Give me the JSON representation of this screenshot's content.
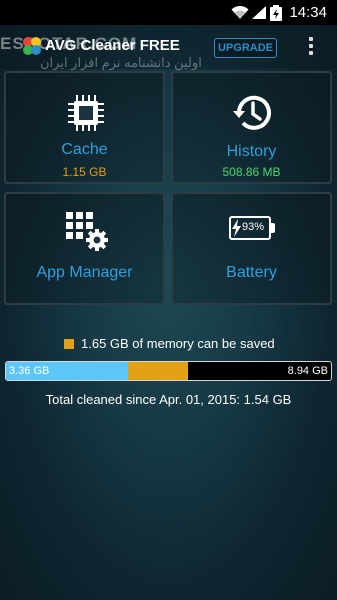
{
  "status_bar": {
    "time": "14:34"
  },
  "app_bar": {
    "title": "AVG Cleaner FREE",
    "upgrade_label": "UPGRADE",
    "watermark": "ESCOTAR.COM",
    "watermark_fa": "اولین دانشنامه نرم افزار ایران"
  },
  "tiles": [
    {
      "label": "Cache",
      "sub": "1.15 GB",
      "sub_color": "#e3a216",
      "icon": "chip-icon"
    },
    {
      "label": "History",
      "sub": "508.86 MB",
      "sub_color": "#4bd46b",
      "icon": "history-clock-icon"
    },
    {
      "label": "App Manager",
      "sub": "",
      "icon": "app-grid-gear-icon"
    },
    {
      "label": "Battery",
      "sub": "",
      "icon": "battery-icon",
      "battery_level": "93%"
    }
  ],
  "memory": {
    "saveable_text": "1.65 GB of memory can be saved",
    "used_label": "3.36 GB",
    "total_label": "8.94 GB",
    "used_fraction": 0.376,
    "saveable_fraction": 0.185,
    "used_color": "#5cc7f6",
    "saveable_color": "#e3a216"
  },
  "total_cleaned": "Total cleaned since Apr. 01, 2015: 1.54 GB"
}
